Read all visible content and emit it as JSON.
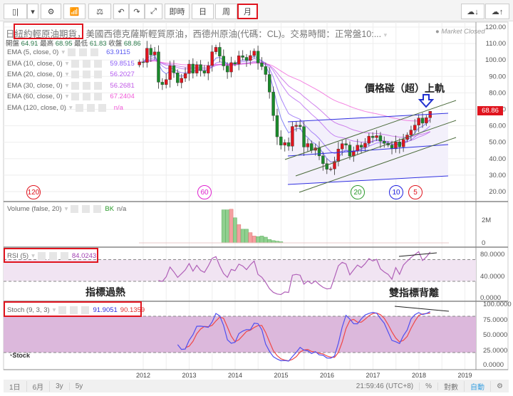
{
  "toolbar": {
    "buttons": [
      "即時",
      "日",
      "周",
      "月"
    ],
    "selected": "月"
  },
  "header": {
    "prefix": "日",
    "name": "紐約輕原油期貨",
    "desc": "，美國西德克薩斯輕質原油，西德州原油(代碼：CL)。交易時間：正常盤10:...",
    "status": "● Market Closed"
  },
  "ohlc": {
    "open_label": "開盤",
    "open": "64.91",
    "high_label": "最高",
    "high": "68.95",
    "low_label": "最低",
    "low": "61.83",
    "close_label": "收盤",
    "close": "68.86"
  },
  "emas": [
    {
      "label": "EMA (5, close, 0)",
      "value": "63.9115",
      "color": "#5b5bf0",
      "period": 5
    },
    {
      "label": "EMA (10, close, 0)",
      "value": "59.8515",
      "color": "#8a5cf5",
      "period": 10
    },
    {
      "label": "EMA (20, close, 0)",
      "value": "56.2027",
      "color": "#b45cf0",
      "period": 20
    },
    {
      "label": "EMA (30, close, 0)",
      "value": "56.2681",
      "color": "#c25ae6",
      "period": 30
    },
    {
      "label": "EMA (60, close, 0)",
      "value": "67.2404",
      "color": "#f05ad8",
      "period": 60
    },
    {
      "label": "EMA (120, close, 0)",
      "value": "n/a",
      "color": "#f05ad8",
      "period": 120
    }
  ],
  "price_tag": "68.86",
  "annotations": {
    "upper_rail": "價格碰（超）上軌",
    "overheat": "指標過熱",
    "divergence": "雙指標背離"
  },
  "circles": [
    {
      "label": "120",
      "color": "#e0141e"
    },
    {
      "label": "60",
      "color": "#e020d0"
    },
    {
      "label": "20",
      "color": "#2a9a2a"
    },
    {
      "label": "10",
      "color": "#2020e0"
    },
    {
      "label": "5",
      "color": "#e0141e"
    }
  ],
  "volume": {
    "label": "Volume (false, 20)",
    "bk": "BK",
    "value": "n/a",
    "ticks": [
      "2M",
      "0"
    ]
  },
  "rsi": {
    "label": "RSI (5)",
    "value": "84.0243",
    "ticks": [
      "80.0000",
      "40.0000",
      "0.0000"
    ]
  },
  "stoch": {
    "label": "Stoch (9, 3, 3)",
    "k": "91.9051",
    "d": "90.1359",
    "ticks": [
      "100.0000",
      "75.0000",
      "50.0000",
      "25.0000",
      "0.0000"
    ]
  },
  "bottom": {
    "ranges": [
      "1日",
      "6月",
      "3y",
      "5y"
    ],
    "time": "21:59:46 (UTC+8)",
    "pct": "%",
    "log": "對數",
    "auto": "自動"
  },
  "chart_data": {
    "type": "candlestick",
    "start": "2011-12",
    "interval": "1M",
    "closes": [
      98.8,
      98.5,
      107.1,
      103.0,
      104.9,
      86.5,
      85.0,
      88.1,
      96.5,
      92.2,
      86.2,
      88.9,
      91.8,
      97.5,
      92.0,
      97.2,
      93.5,
      92.0,
      96.6,
      105.0,
      107.7,
      102.3,
      96.4,
      92.7,
      98.4,
      97.5,
      102.6,
      101.6,
      99.7,
      102.7,
      105.4,
      98.2,
      96.0,
      91.2,
      80.5,
      66.2,
      53.3,
      48.2,
      49.8,
      47.6,
      59.6,
      60.3,
      59.5,
      47.1,
      49.2,
      45.1,
      46.6,
      41.7,
      37.0,
      33.6,
      33.8,
      38.3,
      45.9,
      49.1,
      48.3,
      41.6,
      44.7,
      48.2,
      46.9,
      49.4,
      53.7,
      52.8,
      54.0,
      50.6,
      49.3,
      48.3,
      46.0,
      50.2,
      47.2,
      51.7,
      54.4,
      57.4,
      60.4,
      64.7,
      61.6,
      64.9,
      68.86
    ],
    "last": {
      "open": 64.91,
      "high": 68.95,
      "low": 61.83,
      "close": 68.86
    },
    "volume_M": [
      2.9,
      2.9,
      2.95,
      2.2,
      1.6,
      1.2,
      1.2,
      0.9,
      0.6,
      0.55,
      0.6,
      0.5,
      0.3,
      0.2,
      0.15,
      0.1
    ],
    "volume_start": "2013-11",
    "price_axis": {
      "min": 20,
      "max": 120,
      "ticks": [
        120,
        110,
        100,
        90,
        80,
        70,
        60,
        50,
        40,
        30,
        20
      ]
    },
    "x_ticks": [
      "2012",
      "2013",
      "2014",
      "2015",
      "2016",
      "2017",
      "2018",
      "2019"
    ]
  }
}
